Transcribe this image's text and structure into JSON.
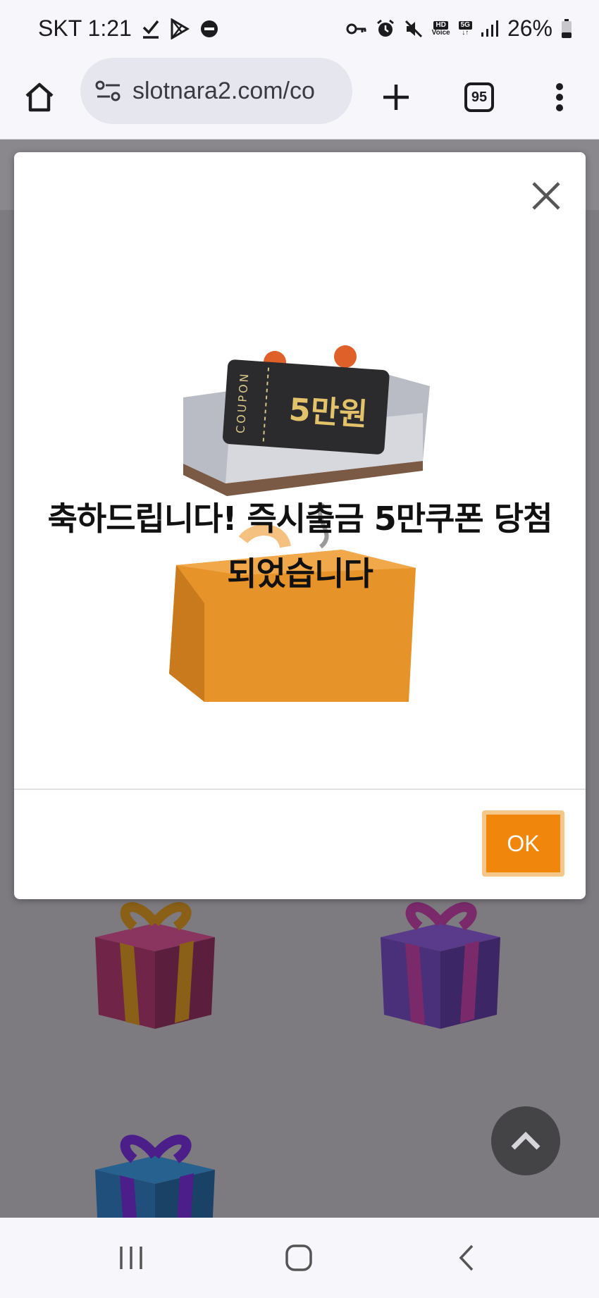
{
  "status_bar": {
    "carrier_time": "SKT 1:21",
    "battery": "26%",
    "icons": [
      "check-icon",
      "play-store-icon",
      "do-not-disturb-icon",
      "key-icon",
      "alarm-icon",
      "mute-icon",
      "hd-voice-icon",
      "5g-icon",
      "signal-icon",
      "battery-icon"
    ],
    "hd_top": "HD",
    "hd_bottom": "Voice",
    "net": "5G"
  },
  "browser": {
    "url": "slotnara2.com/co",
    "tab_count": "95",
    "icons": [
      "home-icon",
      "site-settings-icon",
      "new-tab-icon",
      "tab-switcher-icon",
      "menu-icon"
    ]
  },
  "modal": {
    "coupon_side_label": "COUPON",
    "coupon_amount": "5만원",
    "headline_line1": "축하드립니다! 즉시출금 5만쿠폰 당첨",
    "headline_line2": "되었습니다",
    "ok_label": "OK"
  },
  "background": {
    "gift_colors": [
      "#7a2a50",
      "#4a2f7a",
      "#1f4f7a"
    ]
  },
  "navigation": {
    "icons": [
      "recent-apps-icon",
      "home-circle-icon",
      "back-icon"
    ]
  }
}
